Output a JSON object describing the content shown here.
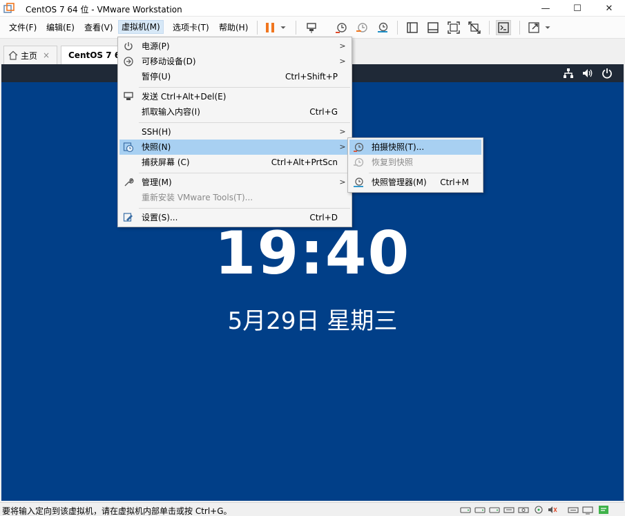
{
  "window": {
    "title": "CentOS 7 64 位 - VMware Workstation",
    "minimize": "—",
    "maximize": "☐",
    "close": "✕"
  },
  "menubar": {
    "items": [
      "文件(F)",
      "编辑(E)",
      "查看(V)",
      "虚拟机(M)",
      "选项卡(T)",
      "帮助(H)"
    ],
    "active": "虚拟机(M)"
  },
  "toolbar": {
    "icons": [
      "pause-icon",
      "dropdown-caret-icon",
      "send-ctrl-alt-del-icon",
      "take-snapshot-icon",
      "revert-snapshot-icon",
      "snapshot-manager-icon",
      "show-library-icon",
      "thumbnail-bar-icon",
      "fullscreen-icon",
      "unity-icon",
      "console-view-icon",
      "stretch-icon",
      "dropdown-caret-icon"
    ],
    "accent": "#f0761f"
  },
  "tabs": [
    {
      "label": "主页",
      "close": "×"
    },
    {
      "label": "CentOS 7 6",
      "close": "×"
    }
  ],
  "vm_menu": {
    "items": [
      {
        "label": "电源(P)",
        "shortcut": "",
        "submenu": true,
        "icon": "power-icon"
      },
      {
        "label": "可移动设备(D)",
        "shortcut": "",
        "submenu": true,
        "icon": "removable-device-icon"
      },
      {
        "label": "暂停(U)",
        "shortcut": "Ctrl+Shift+P",
        "submenu": false,
        "icon": ""
      },
      {
        "label": "发送 Ctrl+Alt+Del(E)",
        "shortcut": "",
        "submenu": false,
        "icon": "send-keys-icon"
      },
      {
        "label": "抓取输入内容(I)",
        "shortcut": "Ctrl+G",
        "submenu": false,
        "icon": ""
      },
      {
        "label": "SSH(H)",
        "shortcut": "",
        "submenu": true,
        "icon": ""
      },
      {
        "label": "快照(N)",
        "shortcut": "",
        "submenu": true,
        "icon": "snapshot-icon",
        "highlighted": true
      },
      {
        "label": "捕获屏幕 (C)",
        "shortcut": "Ctrl+Alt+PrtScn",
        "submenu": false,
        "icon": ""
      },
      {
        "label": "管理(M)",
        "shortcut": "",
        "submenu": true,
        "icon": "wrench-icon"
      },
      {
        "label": "重新安装 VMware Tools(T)...",
        "shortcut": "",
        "submenu": false,
        "icon": "",
        "disabled": true
      },
      {
        "label": "设置(S)...",
        "shortcut": "Ctrl+D",
        "submenu": false,
        "icon": "settings-icon"
      }
    ]
  },
  "snapshot_menu": {
    "items": [
      {
        "label": "拍摄快照(T)...",
        "shortcut": "",
        "highlighted": true,
        "icon": "take-snapshot-icon"
      },
      {
        "label": "恢复到快照",
        "shortcut": "",
        "disabled": true,
        "icon": "revert-snapshot-icon"
      },
      {
        "label": "快照管理器(M)",
        "shortcut": "Ctrl+M",
        "icon": "snapshot-manager-icon"
      }
    ]
  },
  "guest": {
    "background": "#013f88",
    "time": "19:40",
    "date": "5月29日 星期三",
    "topbar_icons": [
      "network-icon",
      "volume-icon",
      "power-icon"
    ]
  },
  "statusbar": {
    "text": "要将输入定向到该虚拟机，请在虚拟机内部单击或按 Ctrl+G。",
    "icons": [
      "hdd-icon",
      "hdd-icon",
      "hdd-icon",
      "network-icon",
      "cdrom-icon",
      "usb-icon",
      "sound-icon",
      "printer-icon",
      "display-icon",
      "message-icon"
    ]
  }
}
